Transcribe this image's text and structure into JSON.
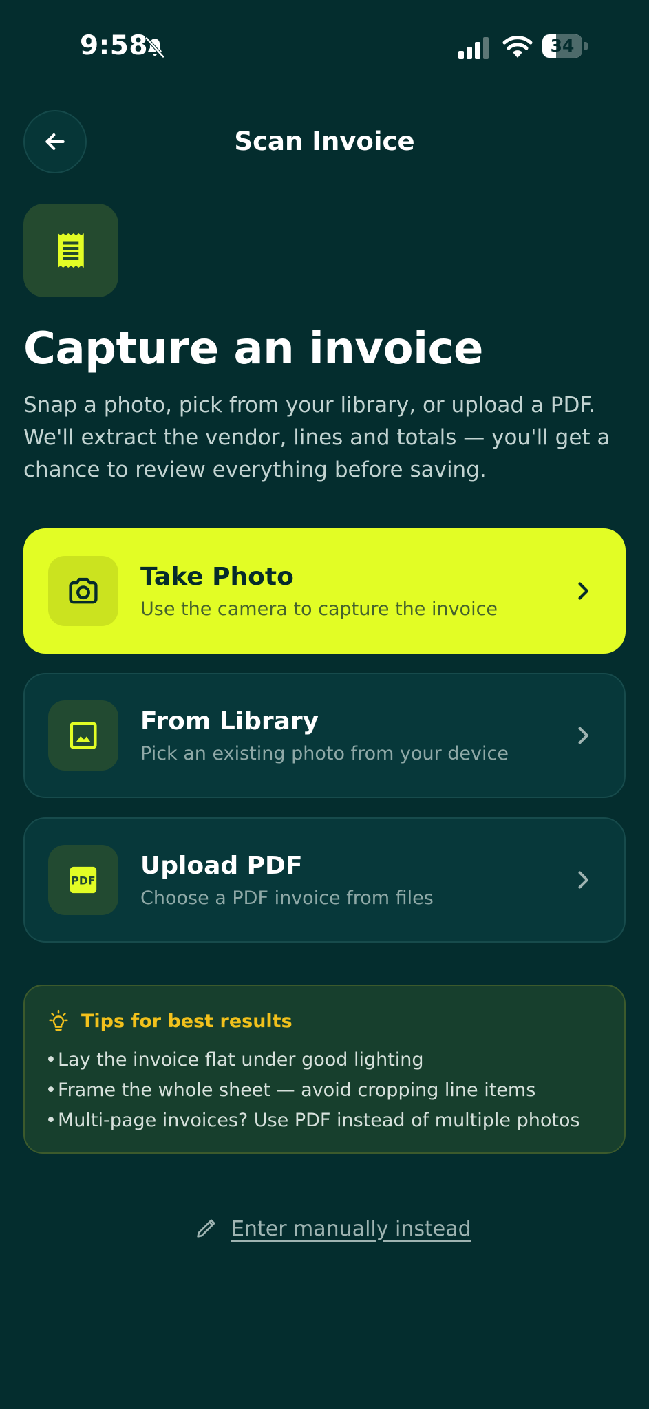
{
  "status_bar": {
    "time": "9:58",
    "battery_level": "34",
    "battery_fraction": 0.34
  },
  "header": {
    "title": "Scan Invoice",
    "back_icon": "arrow-left-icon"
  },
  "hero": {
    "icon": "receipt-icon",
    "headline": "Capture an invoice",
    "description": "Snap a photo, pick from your library, or upload a PDF. We'll extract the vendor, lines and totals — you'll get a chance to review everything before saving."
  },
  "options": [
    {
      "title": "Take Photo",
      "subtitle": "Use the camera to capture the invoice",
      "icon": "camera-icon"
    },
    {
      "title": "From Library",
      "subtitle": "Pick an existing photo from your device",
      "icon": "image-icon"
    },
    {
      "title": "Upload PDF",
      "subtitle": "Choose a PDF invoice from files",
      "icon": "pdf-icon",
      "icon_text": "PDF"
    }
  ],
  "tips": {
    "title": "Tips for best results",
    "icon": "lightbulb-icon",
    "items": [
      "Lay the invoice flat under good lighting",
      "Frame the whole sheet — avoid cropping line items",
      "Multi-page invoices? Use PDF instead of multiple photos"
    ]
  },
  "manual_entry": {
    "label": "Enter manually instead",
    "icon": "pencil-icon"
  },
  "colors": {
    "background": "#042d2e",
    "accent": "#e2fd25",
    "tips_title": "#f2c11c",
    "card_background": "#07383a"
  }
}
